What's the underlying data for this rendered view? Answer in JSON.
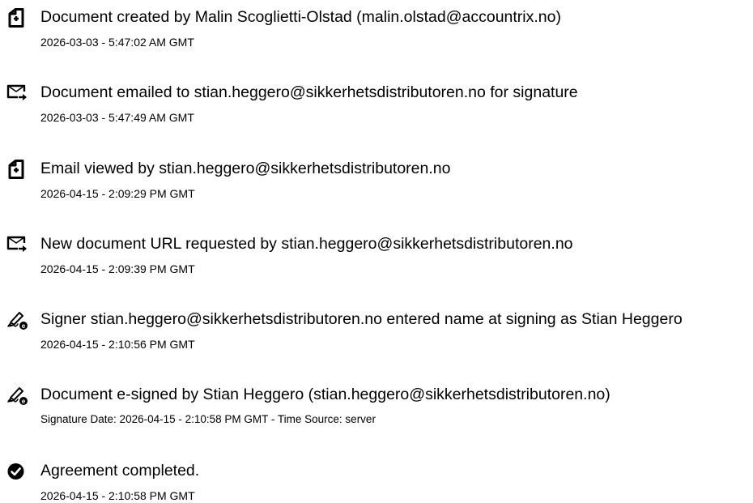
{
  "events": [
    {
      "icon": "document-created-icon",
      "title": "Document created by Malin Scoglietti-Olstad (malin.olstad@accountrix.no)",
      "detail": "2026-03-03 - 5:47:02 AM GMT"
    },
    {
      "icon": "email-sent-icon",
      "title": "Document emailed to stian.heggero@sikkerhetsdistributoren.no for signature",
      "detail": "2026-03-03 - 5:47:49 AM GMT"
    },
    {
      "icon": "document-viewed-icon",
      "title": "Email viewed by stian.heggero@sikkerhetsdistributoren.no",
      "detail": "2026-04-15 - 2:09:29 PM GMT"
    },
    {
      "icon": "url-request-icon",
      "title": "New document URL requested by stian.heggero@sikkerhetsdistributoren.no",
      "detail": "2026-04-15 - 2:09:39 PM GMT"
    },
    {
      "icon": "signature-pen-icon",
      "title": "Signer stian.heggero@sikkerhetsdistributoren.no entered name at signing as Stian Heggero",
      "detail": "2026-04-15 - 2:10:56 PM GMT"
    },
    {
      "icon": "signature-pen-icon",
      "title": "Document e-signed by Stian Heggero (stian.heggero@sikkerhetsdistributoren.no)",
      "detail": "Signature Date: 2026-04-15 - 2:10:58 PM GMT - Time Source: server"
    },
    {
      "icon": "check-circle-icon",
      "title": "Agreement completed.",
      "detail": "2026-04-15 - 2:10:58 PM GMT"
    }
  ]
}
